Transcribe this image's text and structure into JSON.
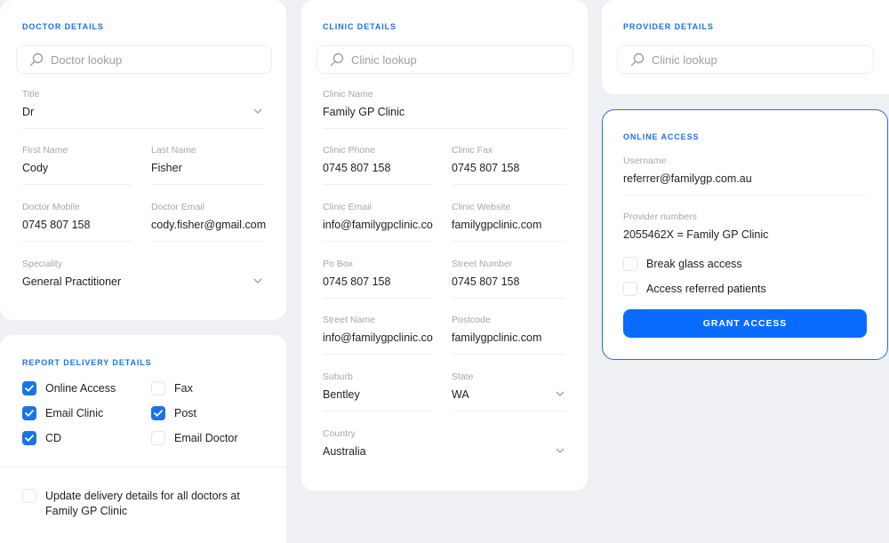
{
  "doctor": {
    "title": "DOCTOR DETAILS",
    "search_placeholder": "Doctor lookup",
    "fields": {
      "title": {
        "label": "Title",
        "value": "Dr"
      },
      "first_name": {
        "label": "First Name",
        "value": "Cody"
      },
      "last_name": {
        "label": "Last Name",
        "value": "Fisher"
      },
      "mobile": {
        "label": "Doctor Mobile",
        "value": "0745 807 158"
      },
      "email": {
        "label": "Doctor Email",
        "value": "cody.fisher@gmail.com"
      },
      "speciality": {
        "label": "Speciality",
        "value": "General Practitioner"
      }
    }
  },
  "clinic": {
    "title": "CLINIC DETAILS",
    "search_placeholder": "Clinic lookup",
    "fields": {
      "name": {
        "label": "Clinic Name",
        "value": "Family GP Clinic"
      },
      "phone": {
        "label": "Clinic Phone",
        "value": "0745 807 158"
      },
      "fax": {
        "label": "Clinic Fax",
        "value": "0745 807 158"
      },
      "email": {
        "label": "Clinic Email",
        "value": "info@familygpclinic.com"
      },
      "website": {
        "label": "Clinic Website",
        "value": "familygpclinic.com"
      },
      "po_box": {
        "label": "Po Box",
        "value": "0745 807 158"
      },
      "street_number": {
        "label": "Street Number",
        "value": "0745 807 158"
      },
      "street_name": {
        "label": "Street Name",
        "value": "info@familygpclinic.com"
      },
      "postcode": {
        "label": "Postcode",
        "value": "familygpclinic.com"
      },
      "suburb": {
        "label": "Suburb",
        "value": "Bentley"
      },
      "state": {
        "label": "State",
        "value": "WA"
      },
      "country": {
        "label": "Country",
        "value": "Australia"
      }
    }
  },
  "provider": {
    "title": "PROVIDER DETAILS",
    "search_placeholder": "Clinic lookup"
  },
  "online_access": {
    "title": "ONLINE ACCESS",
    "username": {
      "label": "Username",
      "value": "referrer@familygp.com.au"
    },
    "provider_numbers": {
      "label": "Provider numbers",
      "value": "2055462X = Family GP Clinic"
    },
    "options": {
      "break_glass": {
        "label": "Break glass access",
        "checked": false
      },
      "referred_patients": {
        "label": "Access referred patients",
        "checked": false
      }
    },
    "grant_label": "GRANT ACCESS"
  },
  "report_delivery": {
    "title": "REPORT DELIVERY DETAILS",
    "options": {
      "online_access": {
        "label": "Online Access",
        "checked": true
      },
      "fax": {
        "label": "Fax",
        "checked": false
      },
      "email_clinic": {
        "label": "Email Clinic",
        "checked": true
      },
      "post": {
        "label": "Post",
        "checked": true
      },
      "cd": {
        "label": "CD",
        "checked": true
      },
      "email_doctor": {
        "label": "Email Doctor",
        "checked": false
      }
    },
    "update_all": {
      "label_line1": "Update delivery details for all doctors at",
      "label_line2": "Family GP Clinic",
      "checked": false
    }
  },
  "colors": {
    "accent": "#1a73e8",
    "button": "#0a6cff",
    "background": "#eef0f3"
  },
  "icons": {
    "search": "search-icon",
    "chevron": "chevron-down-icon",
    "check": "checkmark-icon"
  }
}
